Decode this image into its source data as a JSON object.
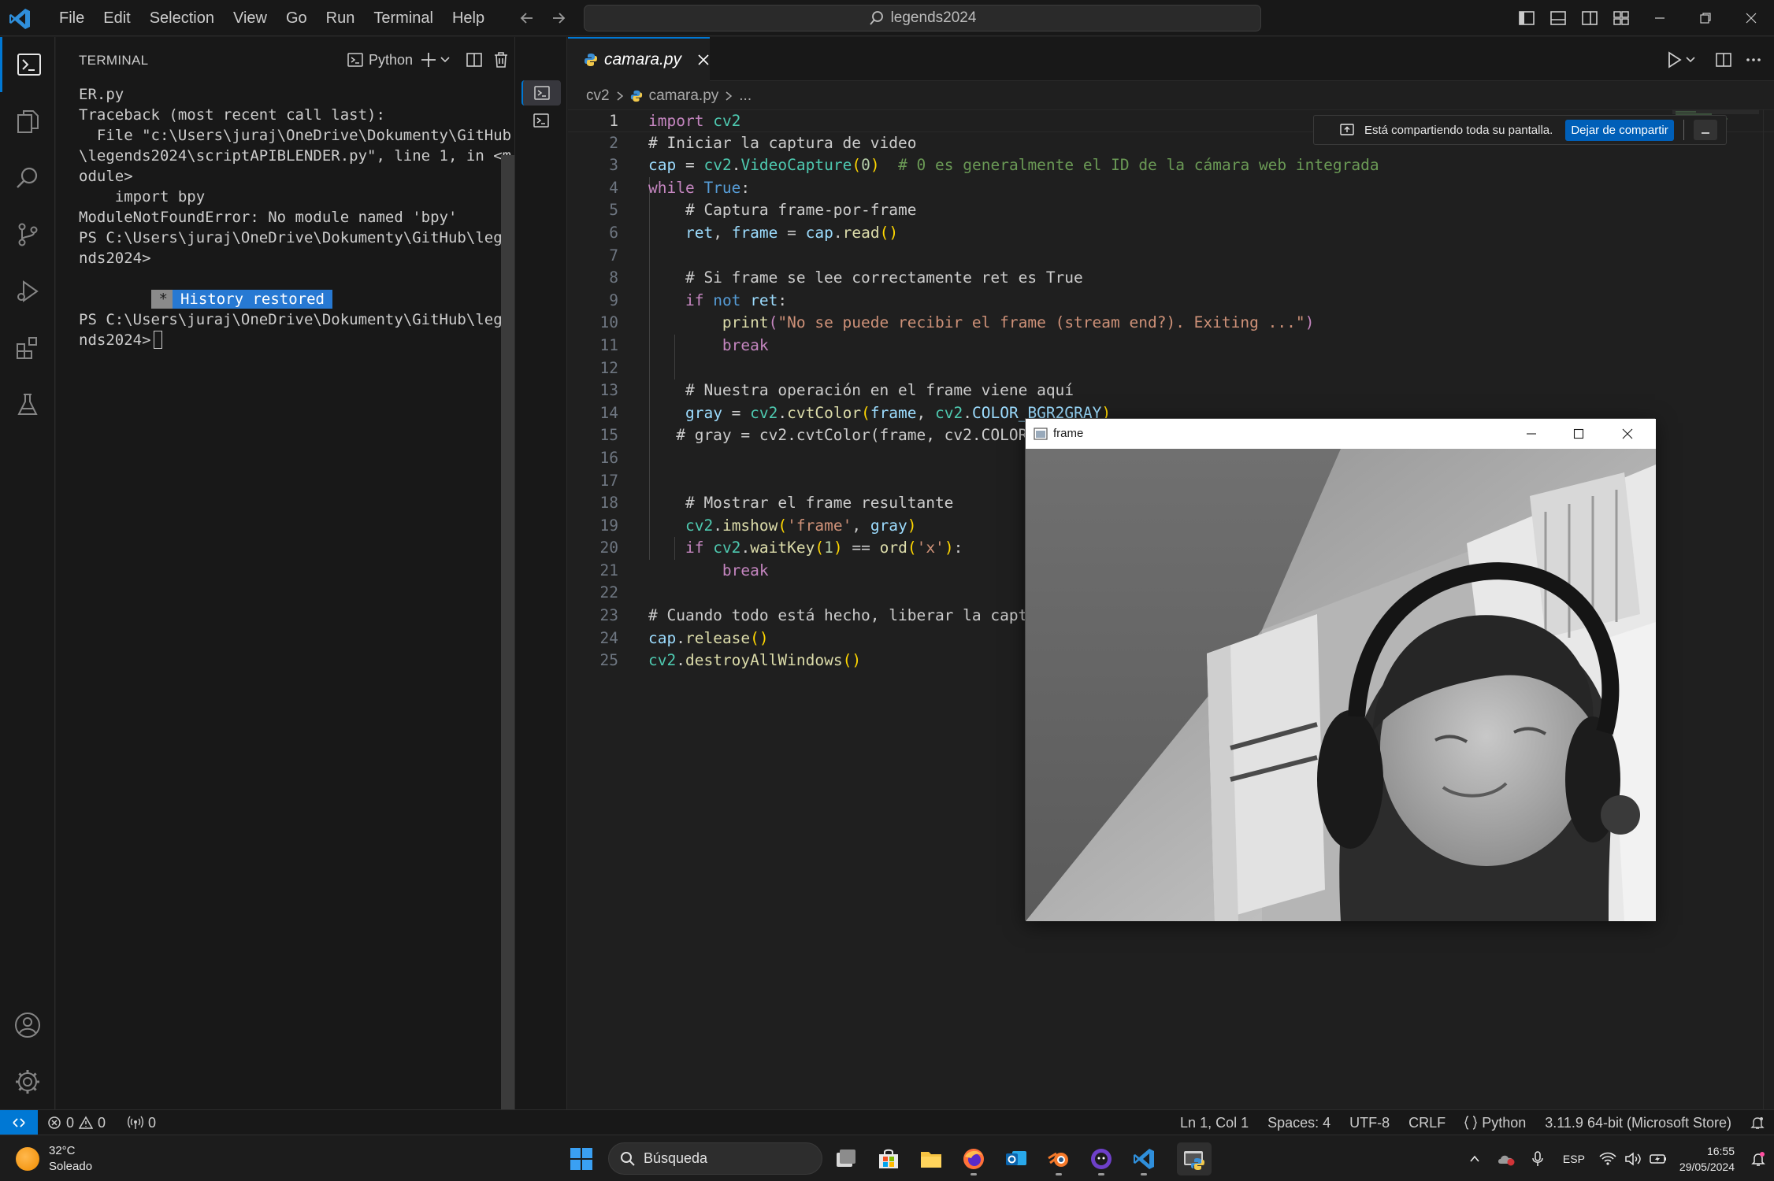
{
  "titlebar": {
    "menu": [
      "File",
      "Edit",
      "Selection",
      "View",
      "Go",
      "Run",
      "Terminal",
      "Help"
    ],
    "command_center": "legends2024"
  },
  "terminal": {
    "title": "TERMINAL",
    "profile": "Python",
    "lines": [
      "ER.py",
      "Traceback (most recent call last):",
      "  File \"c:\\Users\\juraj\\OneDrive\\Dokumenty\\GitHub",
      "\\legends2024\\scriptAPIBLENDER.py\", line 1, in <m",
      "odule>",
      "    import bpy",
      "ModuleNotFoundError: No module named 'bpy'",
      "PS C:\\Users\\juraj\\OneDrive\\Dokumenty\\GitHub\\lege",
      "nds2024>"
    ],
    "badge_star": "*",
    "badge_text": "History restored",
    "prompt_line1": "PS C:\\Users\\juraj\\OneDrive\\Dokumenty\\GitHub\\lege",
    "prompt_line2": "nds2024>"
  },
  "editor": {
    "tab_name": "camara.py",
    "breadcrumb": [
      "cv2",
      "camara.py",
      "..."
    ],
    "line_numbers": [
      "1",
      "2",
      "3",
      "4",
      "5",
      "6",
      "7",
      "8",
      "9",
      "10",
      "11",
      "12",
      "13",
      "14",
      "15",
      "16",
      "17",
      "18",
      "19",
      "20",
      "21",
      "22",
      "23",
      "24",
      "25"
    ],
    "code": [
      "import cv2",
      "# Iniciar la captura de video",
      "cap = cv2.VideoCapture(0)  # 0 es generalmente el ID de la cámara web integrada",
      "while True:",
      "    # Captura frame-por-frame",
      "    ret, frame = cap.read()",
      "",
      "    # Si frame se lee correctamente ret es True",
      "    if not ret:",
      "        print(\"No se puede recibir el frame (stream end?). Exiting ...\")",
      "        break",
      "",
      "    # Nuestra operación en el frame viene aquí",
      "    gray = cv2.cvtColor(frame, cv2.COLOR_BGR2GRAY)",
      "   # gray = cv2.cvtColor(frame, cv2.COLOR",
      "",
      "",
      "    # Mostrar el frame resultante",
      "    cv2.imshow('frame', gray)",
      "    if cv2.waitKey(1) == ord('x'):",
      "        break",
      "",
      "# Cuando todo está hecho, liberar la captu",
      "cap.release()",
      "cv2.destroyAllWindows()"
    ]
  },
  "share_bar": {
    "text": "Está compartiendo toda su pantalla.",
    "stop_button": "Dejar de compartir"
  },
  "frame_window": {
    "title": "frame"
  },
  "statusbar": {
    "errors": "0",
    "warnings": "0",
    "ports": "0",
    "position": "Ln 1, Col 1",
    "spaces": "Spaces: 4",
    "encoding": "UTF-8",
    "eol": "CRLF",
    "language": "Python",
    "interpreter": "3.11.9 64-bit (Microsoft Store)"
  },
  "taskbar": {
    "temperature": "32°C",
    "weather": "Soleado",
    "search_placeholder": "Búsqueda",
    "language": "ESP",
    "time": "16:55",
    "date": "29/05/2024"
  },
  "colors": {
    "accent": "#0078d4",
    "editor_bg": "#1f1f1f",
    "panel_bg": "#181818",
    "keyword": "#569cd6",
    "comment": "#6a9955",
    "string": "#ce9178",
    "function": "#dcdcaa",
    "variable": "#9cdcfe"
  }
}
